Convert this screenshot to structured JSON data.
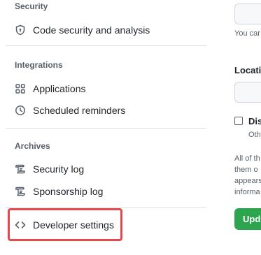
{
  "sidebar": {
    "security": {
      "title": "Security",
      "items": [
        {
          "label": "Code security and analysis",
          "icon": "shield-icon"
        }
      ]
    },
    "integrations": {
      "title": "Integrations",
      "items": [
        {
          "label": "Applications",
          "icon": "apps-icon"
        },
        {
          "label": "Scheduled reminders",
          "icon": "clock-icon"
        }
      ]
    },
    "archives": {
      "title": "Archives",
      "items": [
        {
          "label": "Security log",
          "icon": "log-icon"
        },
        {
          "label": "Sponsorship log",
          "icon": "log-icon"
        }
      ]
    },
    "developer": {
      "label": "Developer settings",
      "icon": "code-icon"
    },
    "highlight_color": "#e5484d"
  },
  "main": {
    "helper_text": "You car",
    "location_label": "Locati",
    "checkbox_label": "Dis",
    "checkbox_sub": "Oth",
    "paragraph": [
      "All of th",
      "them o",
      "appears",
      "informa"
    ],
    "update_button": "Upd",
    "button_color": "#2da44e"
  }
}
